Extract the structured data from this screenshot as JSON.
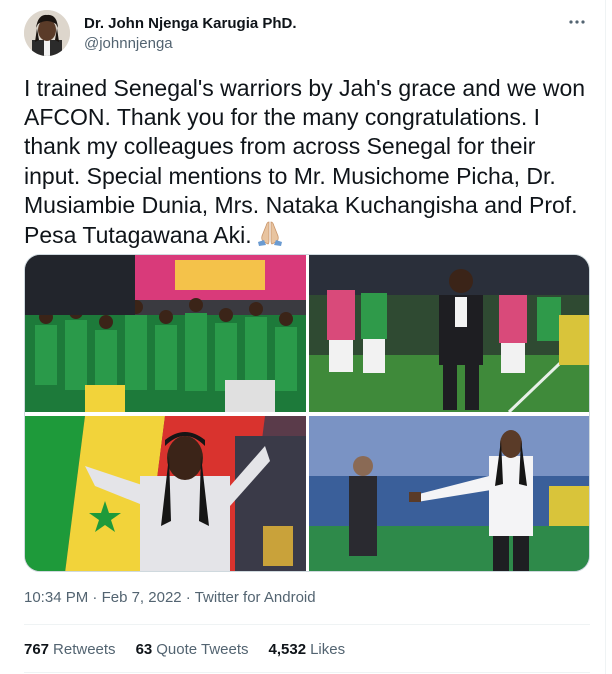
{
  "user": {
    "display_name": "Dr. John Njenga Karugia PhD.",
    "handle": "@johnnjenga",
    "avatar_icon": "profile-photo-icon"
  },
  "more_icon": "ellipsis-icon",
  "tweet": {
    "text": "I trained Senegal's warriors by Jah's grace and we won AFCON. Thank you for the many congratulations. I thank my colleagues from across Senegal for their input. Special mentions to Mr. Musichome Picha, Dr. Musiambie Dunia, Mrs. Nataka Kuchangisha and Prof. Pesa Tutagawana Aki.",
    "emoji_icon": "folded-hands-icon"
  },
  "media": [
    {
      "name": "team-celebration-photo"
    },
    {
      "name": "coach-pitchside-photo"
    },
    {
      "name": "coach-flag-photo"
    },
    {
      "name": "coach-gesturing-photo"
    }
  ],
  "meta": {
    "time": "10:34 PM",
    "separator": "·",
    "date": "Feb 7, 2022",
    "source": "Twitter for Android"
  },
  "stats": {
    "retweets_count": "767",
    "retweets_label": "Retweets",
    "quotes_count": "63",
    "quotes_label": "Quote Tweets",
    "likes_count": "4,532",
    "likes_label": "Likes"
  },
  "colors": {
    "text_primary": "#0f1419",
    "text_secondary": "#536471",
    "border": "#eff3f4"
  }
}
